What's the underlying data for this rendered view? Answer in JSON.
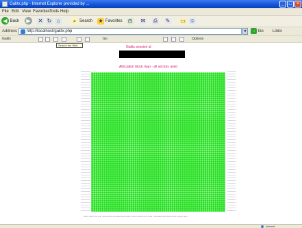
{
  "window": {
    "title": "Gaktx.php - Internet Explorer provided by ...",
    "controls": {
      "minimize": "_",
      "maximize": "□",
      "close": "×"
    }
  },
  "menu": {
    "items": [
      {
        "label": "File"
      },
      {
        "label": "Edit"
      },
      {
        "label": "View"
      },
      {
        "label": "Favorites"
      },
      {
        "label": "Tools"
      },
      {
        "label": "Help"
      }
    ]
  },
  "toolbar": {
    "back_label": "Back",
    "search_label": "Search",
    "favorites_label": "Favorites"
  },
  "address": {
    "label": "Address",
    "value": "http://localhost/gaktx.php",
    "go_label": "Go",
    "links_label": "Links"
  },
  "app_toolbar": {
    "label": "Gaktx",
    "item_a": "Go",
    "item_b": "Options"
  },
  "tooltip": {
    "text": "Search the Web"
  },
  "page": {
    "heading_top": "Gaktx session id",
    "heading_sub": "Allocation block map - all sectors used",
    "footnote": "Each cell in the grid represents one allocation block. Green blocks are used. Total allocated blocks are shown here."
  },
  "grid": {
    "fill_color": "#22e01e",
    "filled_fraction": 1.0
  },
  "status": {
    "text": "Internet"
  },
  "colors": {
    "titlebar": "#1457d8",
    "accent_text": "#d0206a",
    "chrome": "#ece9d8"
  }
}
